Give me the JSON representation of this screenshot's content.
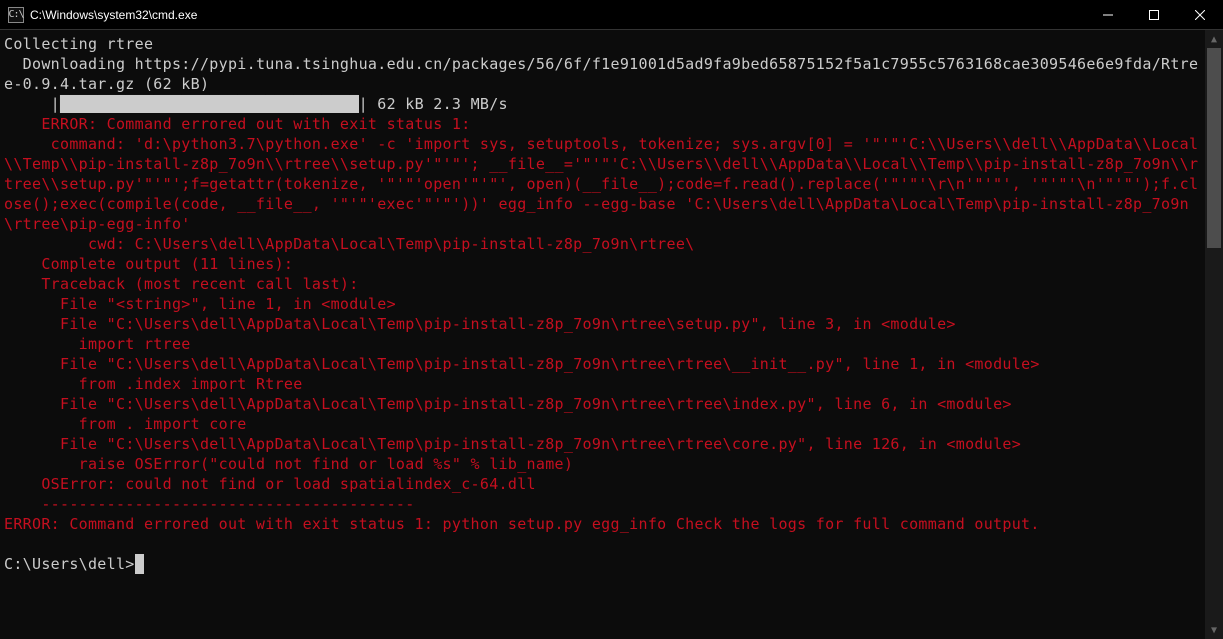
{
  "window": {
    "title": "C:\\Windows\\system32\\cmd.exe",
    "icon_label": "C:\\"
  },
  "term": {
    "l1": "Collecting rtree",
    "l2": "  Downloading https://pypi.tuna.tsinghua.edu.cn/packages/56/6f/f1e91001d5ad9fa9bed65875152f5a1c7955c5763168cae309546e6e9fda/Rtree-0.9.4.tar.gz (62 kB)",
    "progress_prefix": "     |",
    "progress_blocks": "████████████████████████████████",
    "progress_suffix": "| 62 kB 2.3 MB/s",
    "e1": "    ERROR: Command errored out with exit status 1:",
    "e2": "     command: 'd:\\python3.7\\python.exe' -c 'import sys, setuptools, tokenize; sys.argv[0] = '\"'\"'C:\\\\Users\\\\dell\\\\AppData\\\\Local\\\\Temp\\\\pip-install-z8p_7o9n\\\\rtree\\\\setup.py'\"'\"'; __file__='\"'\"'C:\\\\Users\\\\dell\\\\AppData\\\\Local\\\\Temp\\\\pip-install-z8p_7o9n\\\\rtree\\\\setup.py'\"'\"';f=getattr(tokenize, '\"'\"'open'\"'\"', open)(__file__);code=f.read().replace('\"'\"'\\r\\n'\"'\"', '\"'\"'\\n'\"'\"');f.close();exec(compile(code, __file__, '\"'\"'exec'\"'\"'))' egg_info --egg-base 'C:\\Users\\dell\\AppData\\Local\\Temp\\pip-install-z8p_7o9n\\rtree\\pip-egg-info'",
    "e3": "         cwd: C:\\Users\\dell\\AppData\\Local\\Temp\\pip-install-z8p_7o9n\\rtree\\",
    "e4": "    Complete output (11 lines):",
    "e5": "    Traceback (most recent call last):",
    "e6": "      File \"<string>\", line 1, in <module>",
    "e7": "      File \"C:\\Users\\dell\\AppData\\Local\\Temp\\pip-install-z8p_7o9n\\rtree\\setup.py\", line 3, in <module>",
    "e8": "        import rtree",
    "e9": "      File \"C:\\Users\\dell\\AppData\\Local\\Temp\\pip-install-z8p_7o9n\\rtree\\rtree\\__init__.py\", line 1, in <module>",
    "e10": "        from .index import Rtree",
    "e11": "      File \"C:\\Users\\dell\\AppData\\Local\\Temp\\pip-install-z8p_7o9n\\rtree\\rtree\\index.py\", line 6, in <module>",
    "e12": "        from . import core",
    "e13": "      File \"C:\\Users\\dell\\AppData\\Local\\Temp\\pip-install-z8p_7o9n\\rtree\\rtree\\core.py\", line 126, in <module>",
    "e14": "        raise OSError(\"could not find or load %s\" % lib_name)",
    "e15": "    OSError: could not find or load spatialindex_c-64.dll",
    "e16": "    ----------------------------------------",
    "ferr": "ERROR: Command errored out with exit status 1: python setup.py egg_info Check the logs for full command output.",
    "blank": "",
    "prompt": "C:\\Users\\dell>"
  }
}
